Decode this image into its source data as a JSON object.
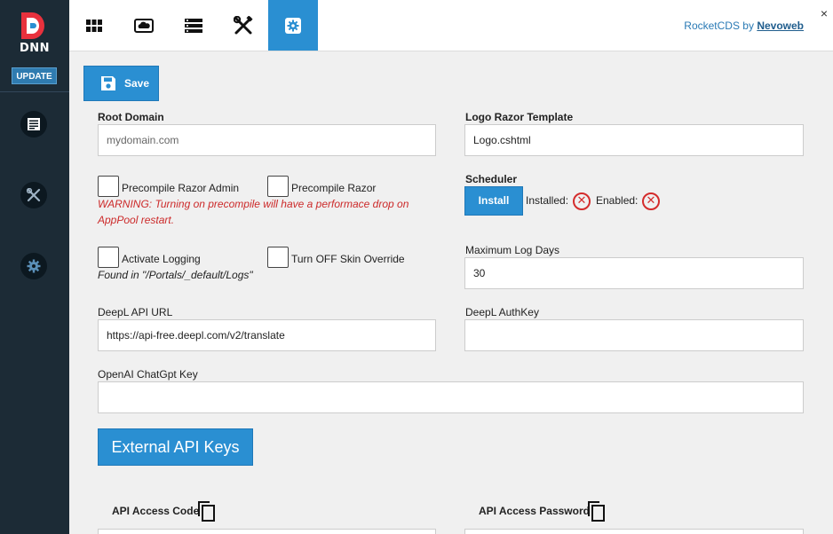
{
  "sidebar": {
    "logo_text": "DNN",
    "update_label": "UPDATE",
    "items": [
      {
        "icon": "page-list-icon"
      },
      {
        "icon": "tools-icon"
      },
      {
        "icon": "settings-gear-icon"
      }
    ]
  },
  "topbar": {
    "tabs": [
      {
        "icon": "grid-icon",
        "active": false
      },
      {
        "icon": "cloud-icon",
        "active": false
      },
      {
        "icon": "list-icon",
        "active": false
      },
      {
        "icon": "tools-icon",
        "active": false
      },
      {
        "icon": "gear-icon",
        "active": true
      }
    ],
    "brand_prefix": "RocketCDS by ",
    "brand_link": "Nevoweb",
    "close_glyph": "×"
  },
  "toolbar": {
    "save_label": "Save"
  },
  "form": {
    "root_domain_label": "Root Domain",
    "root_domain_placeholder": "mydomain.com",
    "logo_template_label": "Logo Razor Template",
    "logo_template_value": "Logo.cshtml",
    "precompile_admin_label": "Precompile Razor Admin",
    "precompile_razor_label": "Precompile Razor",
    "precompile_warning": "WARNING: Turning on precompile will have a performace drop on AppPool restart.",
    "scheduler_label": "Scheduler",
    "install_label": "Install",
    "installed_label": "Installed:",
    "enabled_label": "Enabled:",
    "status_glyph": "✕",
    "activate_logging_label": "Activate Logging",
    "skin_override_label": "Turn OFF Skin Override",
    "logs_path_note": "Found in \"/Portals/_default/Logs\"",
    "max_log_days_label": "Maximum Log Days",
    "max_log_days_value": "30",
    "deepl_url_label": "DeepL API URL",
    "deepl_url_value": "https://api-free.deepl.com/v2/translate",
    "deepl_key_label": "DeepL AuthKey",
    "deepl_key_value": "",
    "openai_key_label": "OpenAI ChatGpt Key",
    "openai_key_value": "",
    "external_keys_label": "External API Keys",
    "api_access_code_label": "API Access Code",
    "api_access_password_label": "API Access Password"
  },
  "colors": {
    "sidebar": "#1c2b36",
    "accent": "#2a8fd2",
    "warning": "#cc2a2a"
  }
}
